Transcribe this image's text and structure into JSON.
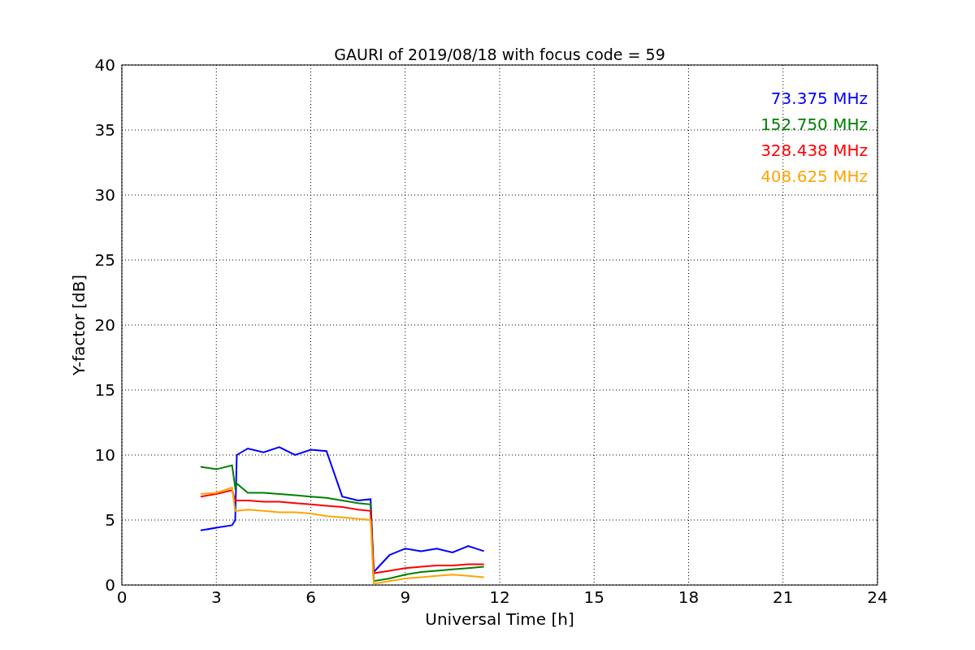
{
  "figure": {
    "chart_data": {
      "type": "line",
      "title": "GAURI of 2019/08/18 with focus code = 59",
      "xlabel": "Universal Time [h]",
      "ylabel": "Y-factor [dB]",
      "x": [
        2.5,
        3,
        3.5,
        3.6,
        3.65,
        4,
        4.5,
        5,
        5.5,
        6,
        6.5,
        7,
        7.5,
        7.9,
        8.0,
        8.5,
        9,
        9.5,
        10,
        10.5,
        11,
        11.5
      ],
      "series": [
        {
          "name": "73.375 MHz",
          "color": "#0000ff",
          "values": [
            4.2,
            4.4,
            4.6,
            5.0,
            10.0,
            10.5,
            10.2,
            10.6,
            10.0,
            10.4,
            10.3,
            6.8,
            6.5,
            6.6,
            1.0,
            2.3,
            2.8,
            2.6,
            2.8,
            2.5,
            3.0,
            2.6
          ]
        },
        {
          "name": "152.750 MHz",
          "color": "#008000",
          "values": [
            9.1,
            8.9,
            9.2,
            7.5,
            7.8,
            7.1,
            7.1,
            7.0,
            6.9,
            6.8,
            6.7,
            6.5,
            6.3,
            6.2,
            0.3,
            0.5,
            0.8,
            1.0,
            1.1,
            1.2,
            1.3,
            1.4
          ]
        },
        {
          "name": "328.438 MHz",
          "color": "#ff0000",
          "values": [
            6.8,
            7.0,
            7.3,
            6.5,
            6.5,
            6.5,
            6.4,
            6.4,
            6.3,
            6.2,
            6.1,
            6.0,
            5.8,
            5.7,
            0.9,
            1.1,
            1.3,
            1.4,
            1.5,
            1.5,
            1.6,
            1.6
          ]
        },
        {
          "name": "408.625 MHz",
          "color": "#ffa500",
          "values": [
            7.0,
            7.1,
            7.5,
            5.7,
            5.7,
            5.8,
            5.7,
            5.6,
            5.6,
            5.5,
            5.3,
            5.2,
            5.1,
            5.0,
            0.1,
            0.3,
            0.5,
            0.6,
            0.7,
            0.8,
            0.7,
            0.6
          ]
        }
      ],
      "xlim": [
        0,
        24
      ],
      "ylim": [
        0,
        40
      ],
      "xticks": [
        0,
        3,
        6,
        9,
        12,
        15,
        18,
        21,
        24
      ],
      "yticks": [
        0,
        5,
        10,
        15,
        20,
        25,
        30,
        35,
        40
      ],
      "grid": true
    }
  }
}
